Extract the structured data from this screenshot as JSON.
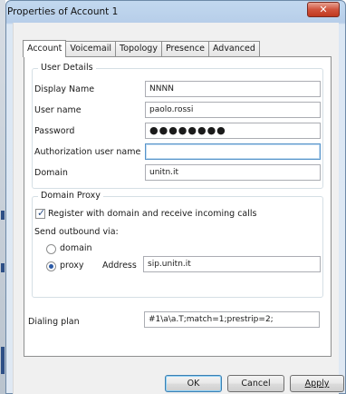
{
  "window": {
    "title": "Properties of Account 1",
    "close_glyph": "✕"
  },
  "tabs": [
    "Account",
    "Voicemail",
    "Topology",
    "Presence",
    "Advanced"
  ],
  "user_details": {
    "title": "User Details",
    "display_name_label": "Display Name",
    "display_name_value": "NNNN",
    "user_name_label": "User name",
    "user_name_value": "paolo.rossi",
    "password_label": "Password",
    "password_value": "●●●●●●●●",
    "auth_user_label": "Authorization user name",
    "auth_user_value": "",
    "domain_label": "Domain",
    "domain_value": "unitn.it"
  },
  "domain_proxy": {
    "title": "Domain Proxy",
    "register_label": "Register with domain and receive incoming calls",
    "register_checked": true,
    "send_outbound_label": "Send outbound via:",
    "options": [
      "domain",
      "proxy"
    ],
    "selected_option": "proxy",
    "address_label": "Address",
    "address_value": "sip.unitn.it"
  },
  "dialing_plan": {
    "label": "Dialing plan",
    "value": "#1\\a\\a.T;match=1;prestrip=2;"
  },
  "buttons": {
    "ok": "OK",
    "cancel": "Cancel",
    "apply": "Apply"
  },
  "icons": {
    "check": "check-icon",
    "close": "close-icon"
  },
  "colors": {
    "titlebar": "#c2d8ef",
    "close_button": "#d0533d",
    "focus_border": "#5593c9"
  }
}
